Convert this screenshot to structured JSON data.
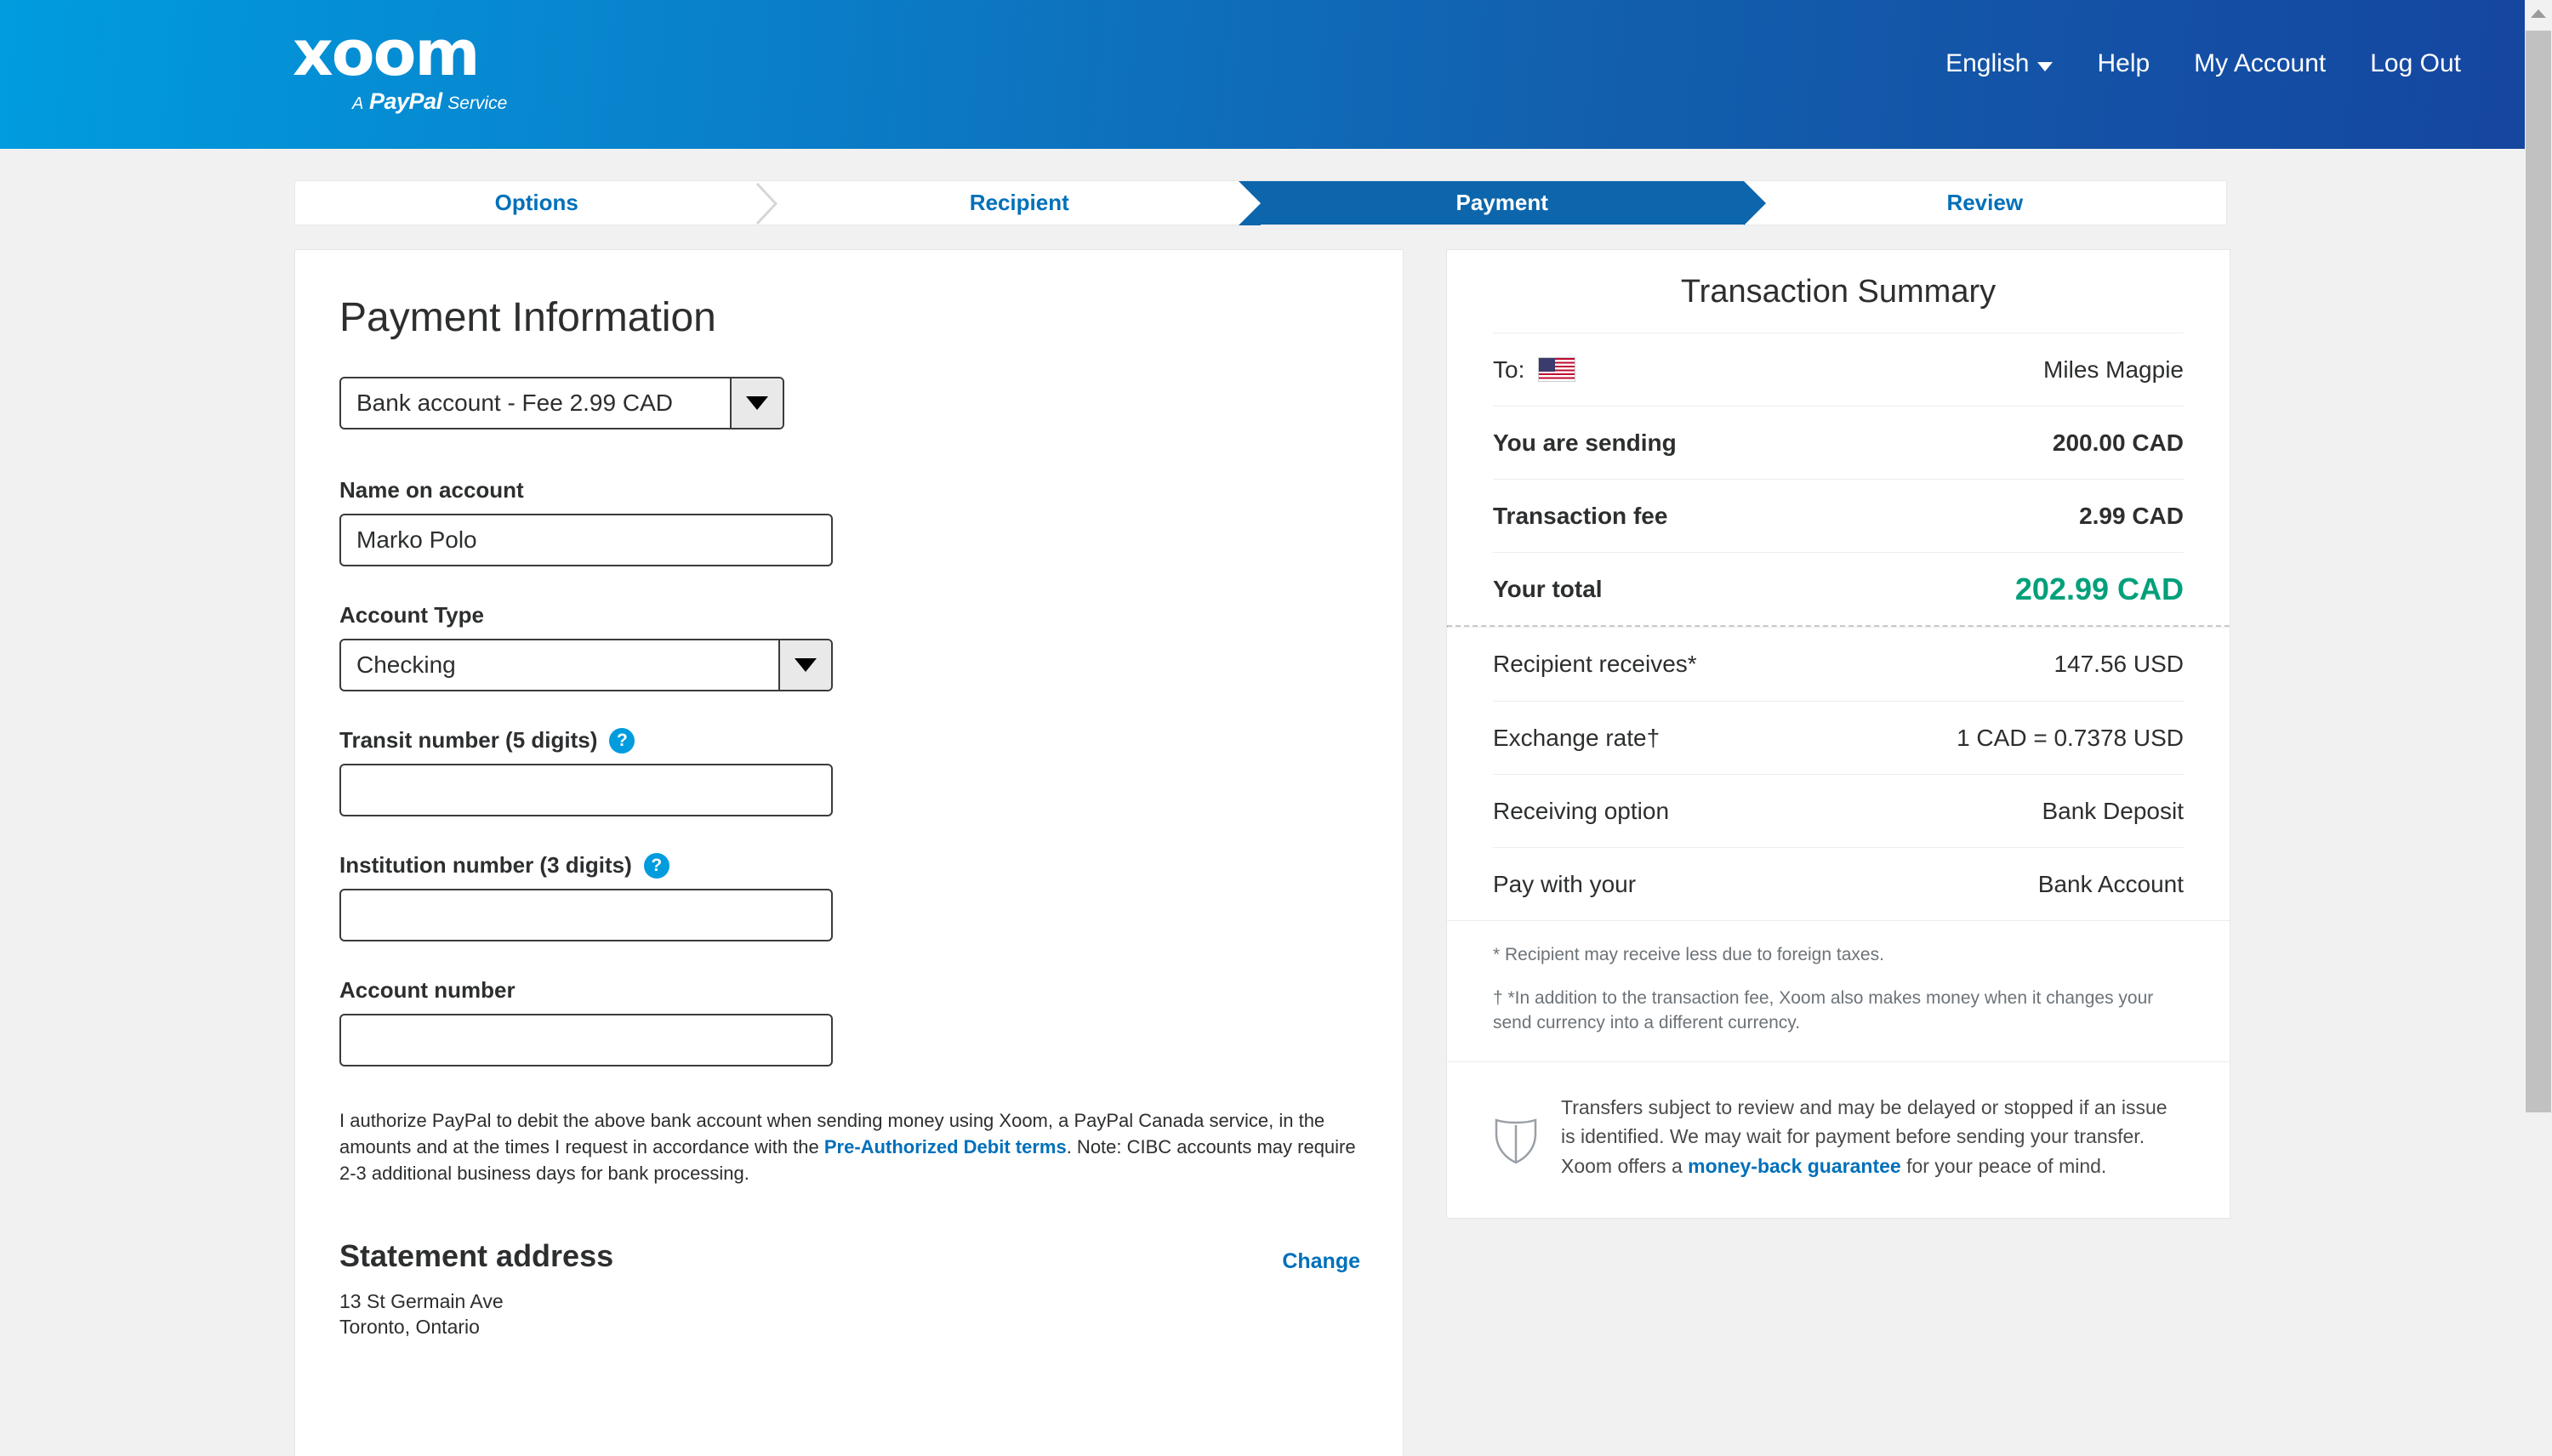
{
  "header": {
    "logo_word": "xoom",
    "logo_sub_a": "A",
    "logo_sub_paypal": "PayPal",
    "logo_sub_service": "Service",
    "nav": [
      {
        "label": "English",
        "has_caret": true
      },
      {
        "label": "Help",
        "has_caret": false
      },
      {
        "label": "My Account",
        "has_caret": false
      },
      {
        "label": "Log Out",
        "has_caret": false
      }
    ],
    "gradient_start": "#009cde",
    "gradient_end": "#1546a0"
  },
  "steps": [
    {
      "label": "Options",
      "active": false
    },
    {
      "label": "Recipient",
      "active": false
    },
    {
      "label": "Payment",
      "active": true
    },
    {
      "label": "Review",
      "active": false
    }
  ],
  "form": {
    "title": "Payment Information",
    "payment_method_value": "Bank account - Fee 2.99 CAD",
    "name_label": "Name on account",
    "name_value": "Marko Polo",
    "account_type_label": "Account Type",
    "account_type_value": "Checking",
    "transit_label": "Transit number (5 digits)",
    "transit_value": "",
    "institution_label": "Institution number (3 digits)",
    "institution_value": "",
    "account_number_label": "Account number",
    "account_number_value": "",
    "help_glyph": "?",
    "authorize_pre": "I authorize PayPal to debit the above bank account when sending money using Xoom, a PayPal Canada service, in the amounts and at the times I request in accordance with the ",
    "authorize_link": "Pre-Authorized Debit terms",
    "authorize_post": ". Note: CIBC accounts may require 2-3 additional business days for bank processing.",
    "statement_title": "Statement address",
    "statement_change": "Change",
    "statement_line1": "13 St Germain Ave",
    "statement_line2": "Toronto, Ontario"
  },
  "summary": {
    "title": "Transaction Summary",
    "to_label": "To:",
    "to_value": "Miles Magpie",
    "rows_primary": [
      {
        "key": "You are sending",
        "value": "200.00  CAD",
        "bold": true
      },
      {
        "key": "Transaction fee",
        "value": "2.99  CAD",
        "bold": true
      }
    ],
    "total": {
      "key": "Your total",
      "value": "202.99  CAD",
      "color": "#00a07a"
    },
    "rows_secondary": [
      {
        "key": "Recipient receives*",
        "value": "147.56  USD"
      },
      {
        "key": "Exchange rate†",
        "value": "1 CAD = 0.7378 USD"
      },
      {
        "key": "Receiving option",
        "value": "Bank Deposit"
      },
      {
        "key": "Pay with your",
        "value": "Bank Account"
      }
    ],
    "note_1": "* Recipient may receive less due to foreign taxes.",
    "note_2": "† *In addition to the transaction fee, Xoom also makes money when it changes your send currency into a different currency.",
    "guarantee_pre": "Transfers subject to review and may be delayed or stopped if an issue is identified. We may wait for payment before sending your transfer. Xoom offers a ",
    "guarantee_link": "money-back guarantee",
    "guarantee_post": " for your peace of mind."
  }
}
